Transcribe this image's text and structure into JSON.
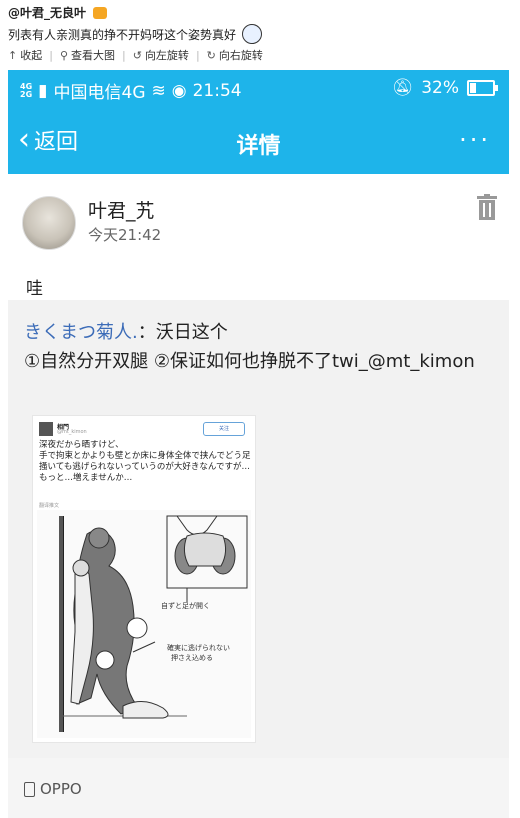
{
  "weibo": {
    "author": "@叶君_无良叶",
    "caption": "列表有人亲测真的挣不开妈呀这个姿势真好",
    "actions": {
      "collect": "收起",
      "view_large": "查看大图",
      "rotate_left": "向左旋转",
      "rotate_right": "向右旋转"
    }
  },
  "status_bar": {
    "network_small": [
      "4G",
      "2G"
    ],
    "carrier": "中国电信4G",
    "time": "21:54",
    "battery": "32%",
    "battery_level": 0.32
  },
  "nav": {
    "back_label": "返回",
    "title": "详情",
    "more": "···"
  },
  "post": {
    "username": "叶君_艽",
    "time": "今天21:42",
    "text": "哇"
  },
  "repost": {
    "user": "きくまつ菊人.",
    "sep": "：",
    "text": "沃日这个\n①自然分开双腿 ②保证如何也挣脱不了twi_@mt_kimon",
    "image": {
      "tweet_name": "相門",
      "tweet_handle": "@mt_kimon",
      "follow_label": "关注",
      "tweet_text": "深夜だから晒すけど、\n手で拘束とかよりも壁とか床に身体全体で挟んでどう足掻いても逃げられないっていうのが大好きなんですが…もっと…増えませんか…",
      "tweet_sub": "翻译推文",
      "art_labels": {
        "notes1": "自ずと足が開く",
        "notes2": "確実に逃げられない",
        "notes3": "押さえ込める"
      }
    }
  },
  "device": {
    "name": "OPPO"
  },
  "colors": {
    "accent": "#1eb4ea",
    "link": "#3c6cb8"
  }
}
